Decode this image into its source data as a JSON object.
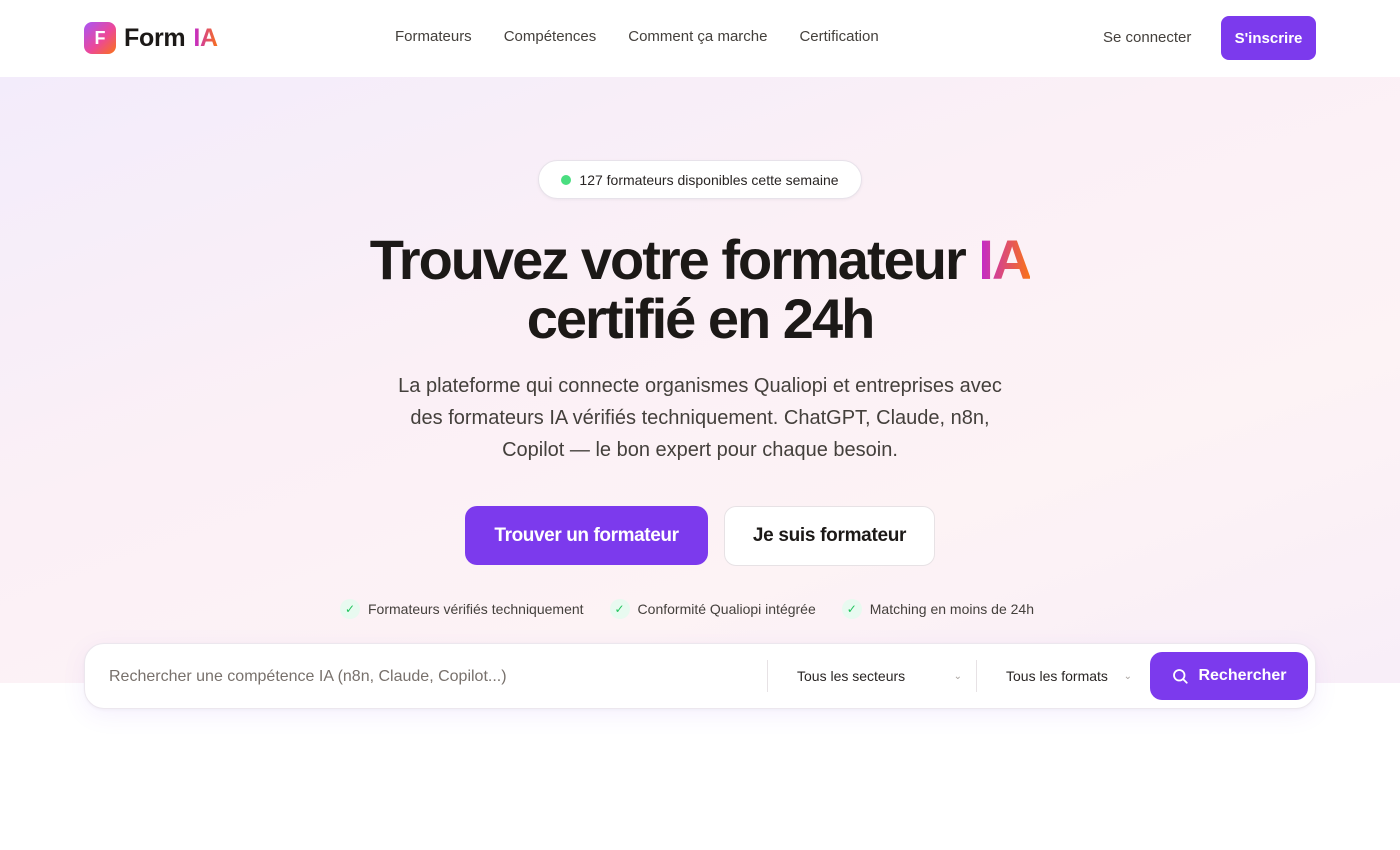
{
  "header": {
    "logo_letter": "F",
    "logo_text": "Form",
    "logo_accent": "IA",
    "nav": [
      {
        "label": "Formateurs"
      },
      {
        "label": "Compétences"
      },
      {
        "label": "Comment ça marche"
      },
      {
        "label": "Certification"
      }
    ],
    "login_label": "Se connecter",
    "signup_label": "S'inscrire"
  },
  "hero": {
    "badge_text": "127 formateurs disponibles cette semaine",
    "headline_part1": "Trouvez votre formateur ",
    "headline_accent": "IA",
    "headline_part2": "certifié en 24h",
    "subtitle": "La plateforme qui connecte organismes Qualiopi et entreprises avec des formateurs IA vérifiés techniquement. ChatGPT, Claude, n8n, Copilot — le bon expert pour chaque besoin.",
    "cta_primary": "Trouver un formateur",
    "cta_secondary": "Je suis formateur",
    "features": [
      {
        "label": "Formateurs vérifiés techniquement"
      },
      {
        "label": "Conformité Qualiopi intégrée"
      },
      {
        "label": "Matching en moins de 24h"
      }
    ]
  },
  "search": {
    "placeholder": "Rechercher une compétence IA (n8n, Claude, Copilot...)",
    "value": "",
    "sector_selected": "Tous les secteurs",
    "format_selected": "Tous les formats",
    "button_label": "Rechercher"
  },
  "icons": {
    "logo": "logo-mark-icon",
    "badge": "green-status-dot-icon",
    "check": "check-icon",
    "chevron": "chevron-down-icon",
    "search": "search-icon"
  },
  "colors": {
    "brand_purple": "#7c3aed",
    "accent_gradient_start": "#c026d3",
    "accent_gradient_end": "#f97316",
    "status_green": "#4ade80",
    "text_dark": "#1c1917"
  }
}
